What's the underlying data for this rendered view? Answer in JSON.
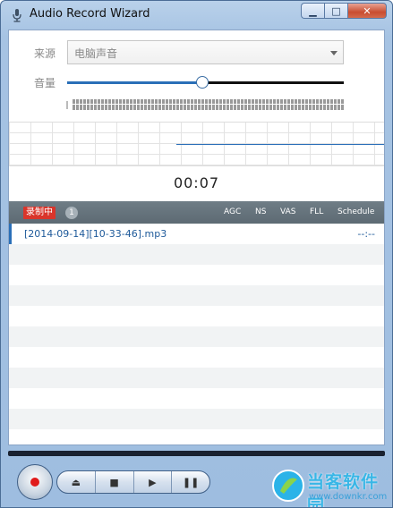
{
  "window": {
    "title": "Audio Record Wizard",
    "minimize_glyph": "▁",
    "maximize_glyph": "□",
    "close_glyph": "✕"
  },
  "source": {
    "label": "来源",
    "selected": "电脑声音"
  },
  "volume": {
    "label": "音量",
    "level_fraction": 0.49
  },
  "timer": "00:07",
  "list_header": {
    "recording_badge": "录制中",
    "count": "1",
    "columns": [
      "AGC",
      "NS",
      "VAS",
      "FLL",
      "Schedule"
    ]
  },
  "files": [
    {
      "name": "[2014-09-14][10-33-46].mp3",
      "time": "--:--"
    }
  ],
  "progress_fraction": 0,
  "controls": {
    "eject": "⏏",
    "stop": "■",
    "play": "▶",
    "pause": "❚❚"
  },
  "watermark": {
    "text": "当客软件园",
    "url": "www.downkr.com"
  },
  "colors": {
    "accent": "#2a6fb8",
    "record_red": "#e01b1b",
    "header_bar": "#66737c"
  }
}
